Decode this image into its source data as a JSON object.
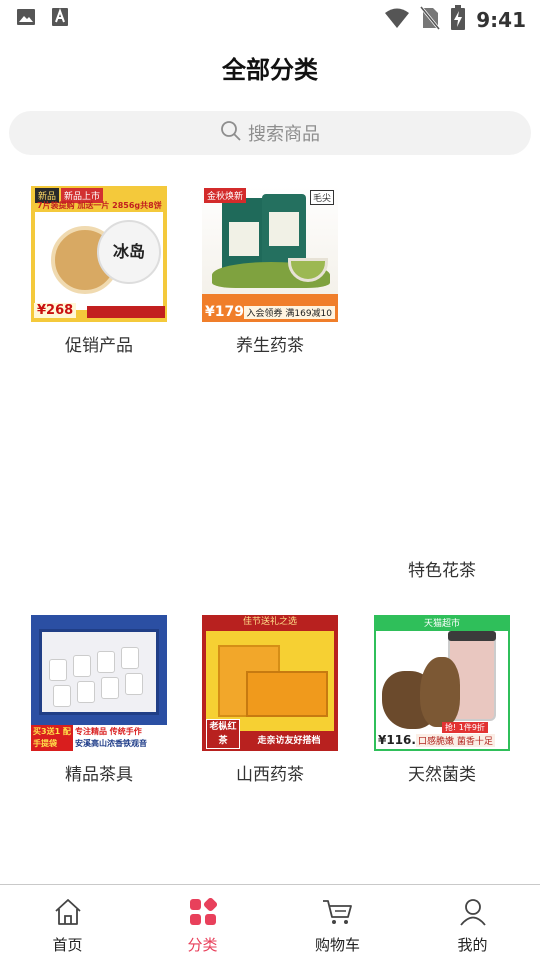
{
  "status_bar": {
    "time": "9:41",
    "left_icons": [
      "image-icon",
      "text-a-icon"
    ],
    "right_icons": [
      "wifi-icon",
      "no-sim-icon",
      "battery-charging-icon"
    ]
  },
  "header": {
    "title": "全部分类"
  },
  "search": {
    "placeholder": "搜索商品"
  },
  "categories": [
    {
      "label": "促销产品",
      "thumb": {
        "tag_top": "新品",
        "tag_new": "新品上市",
        "headline": "7片装提购 加送一片 2856g共8饼",
        "cake_text": "冰岛",
        "price": "¥268"
      }
    },
    {
      "label": "养生药茶",
      "thumb": {
        "tag": "金秋焕新",
        "brand": "毛尖",
        "price": "¥179",
        "deal": "入会领券 满169减10"
      }
    },
    {
      "label": "特色花茶"
    },
    {
      "label": "精品茶具",
      "thumb": {
        "red_tag": "买3送1 配手提袋",
        "line1": "专注精品 传统手作",
        "line2": "安溪高山浓香铁观音"
      }
    },
    {
      "label": "山西药茶",
      "thumb": {
        "top": "佳节送礼之选",
        "lab": "老枞红茶",
        "slogan": "走亲访友好搭档"
      }
    },
    {
      "label": "天然菌类",
      "thumb": {
        "top": "天猫超市",
        "deal": "抢! 1件9折",
        "price": "¥116.1",
        "desc": "口感脆嫩 菌香十足"
      }
    }
  ],
  "tabbar": [
    {
      "label": "首页",
      "icon": "home-icon",
      "active": false
    },
    {
      "label": "分类",
      "icon": "category-icon",
      "active": true
    },
    {
      "label": "购物车",
      "icon": "cart-icon",
      "active": false
    },
    {
      "label": "我的",
      "icon": "user-icon",
      "active": false
    }
  ],
  "colors": {
    "accent": "#e8405b",
    "search_bg": "#f2f2f2",
    "text": "#333333",
    "muted": "#8e8e8e"
  }
}
